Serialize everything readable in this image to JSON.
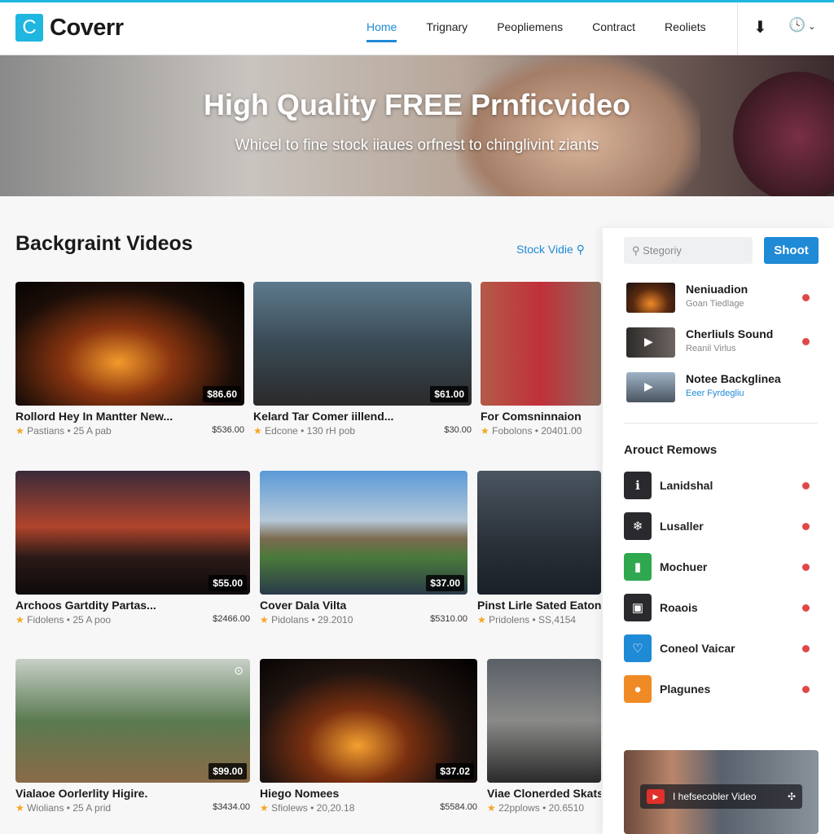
{
  "header": {
    "logo_letter": "C",
    "logo": "Coverr",
    "nav": [
      "Home",
      "Trignary",
      "Peopliemens",
      "Contract",
      "Reoliets"
    ],
    "active_nav": "Home"
  },
  "hero": {
    "title": "High Quality FREE Prnficvideo",
    "subtitle": "Whicel to fine stock iiaues orfnest to chinglivint ziants"
  },
  "section": {
    "title": "Backgraint Videos",
    "stock_link": "Stock Vidie"
  },
  "videos": [
    {
      "title": "Rollord Hey In Mantter New...",
      "meta": "Pastians • 25 A pab",
      "price": "$536.00",
      "tag": "$86.60"
    },
    {
      "title": "Kelard Tar Comer iillend...",
      "meta": "Edcone • 130 rH pob",
      "price": "$30.00",
      "tag": "$61.00"
    },
    {
      "title": "For Comsninnaion",
      "meta": "Fobolons • 20401.00",
      "price": "",
      "tag": ""
    },
    {
      "title": "Archoos Gartdity Partas...",
      "meta": "Fidolens • 25 A poo",
      "price": "$2466.00",
      "tag": "$55.00"
    },
    {
      "title": "Cover Dala Vilta",
      "meta": "Pidolans • 29.2010",
      "price": "$5310.00",
      "tag": "$37.00"
    },
    {
      "title": "Pinst Lirle Sated Eatong",
      "meta": "Pridolens • SS,4154",
      "price": "",
      "tag": ""
    },
    {
      "title": "Vialaoe Oorlerlity Higire.",
      "meta": "Wiolians • 25 A prid",
      "price": "$3434.00",
      "tag": "$99.00"
    },
    {
      "title": "Hiego Nomees",
      "meta": "Sfiolews • 20,20.18",
      "price": "$5584.00",
      "tag": "$37.02"
    },
    {
      "title": "Viae Clonerded Skats",
      "meta": "22pplows • 20.6510",
      "price": "",
      "tag": ""
    }
  ],
  "sidebar": {
    "search_placeholder": "Stegoriy",
    "search_button": "Shoot",
    "related": [
      {
        "title": "Neniuadion",
        "sub": "Goan Tiedlage"
      },
      {
        "title": "Cherliuls Sound",
        "sub": "Reanil Virlus"
      },
      {
        "title": "Notee Backglinea",
        "sub": "Eeer Fyrdegliu"
      }
    ],
    "categories_title": "Arouct Remows",
    "categories": [
      {
        "label": "Lanidshal",
        "icon": "info-icon",
        "color": "#2a2a2e"
      },
      {
        "label": "Lusaller",
        "icon": "snowflake-icon",
        "color": "#2a2a2e"
      },
      {
        "label": "Mochuer",
        "icon": "chart-icon",
        "color": "#2fa84f"
      },
      {
        "label": "Roaois",
        "icon": "screen-icon",
        "color": "#2a2a2e"
      },
      {
        "label": "Coneol Vaicar",
        "icon": "heart-icon",
        "color": "#1f8ad6"
      },
      {
        "label": "Plagunes",
        "icon": "circle-icon",
        "color": "#f08a24"
      }
    ],
    "promo": "I hefsecobler Video"
  },
  "colors": {
    "accent": "#1f8ad6",
    "logo": "#1fb6e0",
    "dot": "#e04848"
  }
}
